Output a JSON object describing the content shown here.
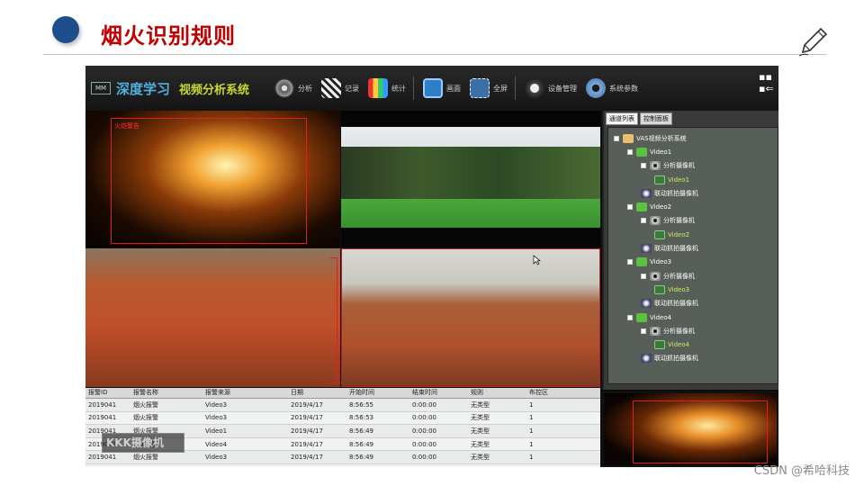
{
  "slide": {
    "title": "烟火识别规则",
    "watermark": "CSDN @希哈科技"
  },
  "app": {
    "logo_text": "MM",
    "name": "深度学习",
    "subtitle": "视频分析系统",
    "toolbar": [
      {
        "label": "分析",
        "icon": "play-disc-icon"
      },
      {
        "label": "记录",
        "icon": "clapperboard-icon"
      },
      {
        "label": "统计",
        "icon": "bar-stats-icon"
      },
      {
        "label": "画面",
        "icon": "screen-icon"
      },
      {
        "label": "全屏",
        "icon": "fullscreen-icon"
      },
      {
        "label": "设备管理",
        "icon": "camera-device-icon"
      },
      {
        "label": "系统参数",
        "icon": "gear-icon"
      }
    ]
  },
  "videos": {
    "v1_tag": "火焰警告"
  },
  "panel": {
    "tabs": [
      "通道列表",
      "控制面板"
    ],
    "tree": [
      {
        "label": "VAS视频分析系统",
        "level": 0,
        "icon": "folder-icon"
      },
      {
        "label": "Video1",
        "level": 1,
        "icon": "video-node-icon"
      },
      {
        "label": "分析摄像机",
        "level": 2,
        "icon": "eye-icon"
      },
      {
        "label": "Video1",
        "level": 3,
        "icon": "camera-icon"
      },
      {
        "label": "联动抓拍摄像机",
        "level": 2,
        "icon": "dome-camera-icon"
      },
      {
        "label": "Video2",
        "level": 1,
        "icon": "video-node-icon"
      },
      {
        "label": "分析摄像机",
        "level": 2,
        "icon": "eye-icon"
      },
      {
        "label": "Video2",
        "level": 3,
        "icon": "camera-icon"
      },
      {
        "label": "联动抓拍摄像机",
        "level": 2,
        "icon": "dome-camera-icon"
      },
      {
        "label": "Video3",
        "level": 1,
        "icon": "video-node-icon"
      },
      {
        "label": "分析摄像机",
        "level": 2,
        "icon": "eye-icon"
      },
      {
        "label": "Video3",
        "level": 3,
        "icon": "camera-icon"
      },
      {
        "label": "联动抓拍摄像机",
        "level": 2,
        "icon": "dome-camera-icon"
      },
      {
        "label": "Video4",
        "level": 1,
        "icon": "video-node-icon"
      },
      {
        "label": "分析摄像机",
        "level": 2,
        "icon": "eye-icon"
      },
      {
        "label": "Video4",
        "level": 3,
        "icon": "camera-icon"
      },
      {
        "label": "联动抓拍摄像机",
        "level": 2,
        "icon": "dome-camera-icon"
      }
    ]
  },
  "table": {
    "headers": [
      "报警ID",
      "报警名称",
      "报警来源",
      "日期",
      "开始时间",
      "结束时间",
      "规则",
      "布控区"
    ],
    "rows": [
      [
        "2019041",
        "烟火报警",
        "Video3",
        "2019/4/17",
        "8:56:55",
        "0:00:00",
        "无类型",
        "1"
      ],
      [
        "2019041",
        "烟火报警",
        "Video3",
        "2019/4/17",
        "8:56:53",
        "0:00:00",
        "无类型",
        "1"
      ],
      [
        "2019041",
        "烟火报警",
        "Video1",
        "2019/4/17",
        "8:56:49",
        "0:00:00",
        "无类型",
        "1"
      ],
      [
        "2019041",
        "烟火报警",
        "Video4",
        "2019/4/17",
        "8:56:49",
        "0:00:00",
        "无类型",
        "1"
      ],
      [
        "2019041",
        "烟火报警",
        "Video3",
        "2019/4/17",
        "8:56:49",
        "0:00:00",
        "无类型",
        "1"
      ]
    ],
    "overlay_logo": "KKK摄像机"
  },
  "colors": {
    "title_red": "#c00000",
    "bullet_blue": "#1f4e8c",
    "app_blue": "#4fb3e0",
    "app_green": "#c8d830",
    "alarm_red": "#e02020"
  }
}
